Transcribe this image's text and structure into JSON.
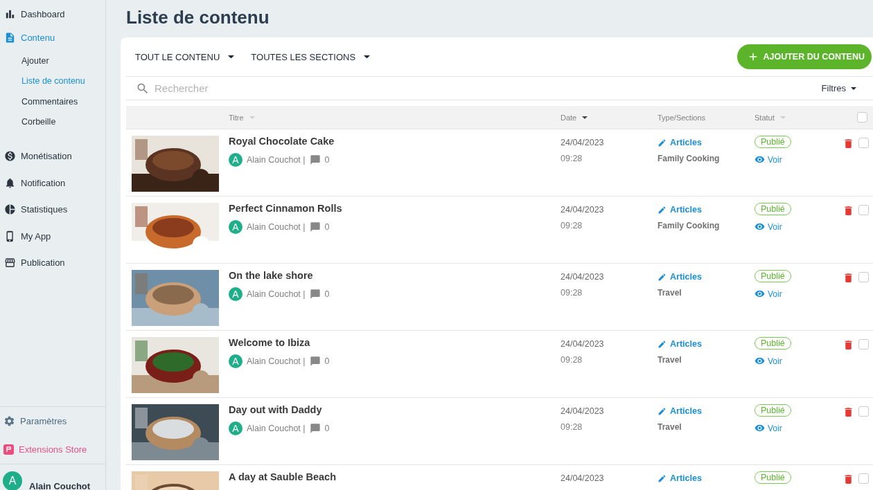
{
  "sidebar": {
    "items": [
      {
        "label": "Dashboard",
        "selected": false
      },
      {
        "label": "Contenu",
        "selected": true,
        "children": [
          {
            "label": "Ajouter",
            "selected": false
          },
          {
            "label": "Liste de contenu",
            "selected": true
          },
          {
            "label": "Commentaires",
            "selected": false
          },
          {
            "label": "Corbeille",
            "selected": false
          }
        ]
      },
      {
        "label": "Monétisation",
        "selected": false
      },
      {
        "label": "Notification",
        "selected": false
      },
      {
        "label": "Statistiques",
        "selected": false
      },
      {
        "label": "My App",
        "selected": false
      },
      {
        "label": "Publication",
        "selected": false
      }
    ],
    "footer": [
      {
        "label": "Paramètres",
        "kind": "settings"
      },
      {
        "label": "Extensions Store",
        "kind": "store"
      }
    ],
    "user": {
      "initial": "A",
      "name": "Alain Couchot"
    }
  },
  "page": {
    "title": "Liste de contenu"
  },
  "toolbar": {
    "dropdowns": [
      "TOUT LE CONTENU",
      "TOUTES LES SECTIONS"
    ],
    "add_button": "AJOUTER DU CONTENU"
  },
  "search": {
    "placeholder": "Rechercher",
    "filters": "Filtres"
  },
  "table": {
    "columns": [
      {
        "label": "Titre",
        "sortable": true,
        "selected": false
      },
      {
        "label": "Date",
        "sortable": true,
        "selected": true
      },
      {
        "label": "Type/Sections",
        "sortable": false
      },
      {
        "label": "Statut",
        "sortable": true,
        "selected": false
      }
    ],
    "select_all": {
      "checked": false
    },
    "rows": [
      {
        "title": "Royal Chocolate Cake",
        "author_initial": "A",
        "author": "Alain Couchot |",
        "comments": "0",
        "date": "24/04/2023",
        "time": "09:28",
        "type": "Articles",
        "section": "Family Cooking",
        "status": "Publié",
        "view": "Voir",
        "checked": false
      },
      {
        "title": "Perfect Cinnamon Rolls",
        "author_initial": "A",
        "author": "Alain Couchot |",
        "comments": "0",
        "date": "24/04/2023",
        "time": "09:28",
        "type": "Articles",
        "section": "Family Cooking",
        "status": "Publié",
        "view": "Voir",
        "checked": false
      },
      {
        "title": "On the lake shore",
        "author_initial": "A",
        "author": "Alain Couchot |",
        "comments": "0",
        "date": "24/04/2023",
        "time": "09:28",
        "type": "Articles",
        "section": "Travel",
        "status": "Publié",
        "view": "Voir",
        "checked": false
      },
      {
        "title": "Welcome to Ibiza",
        "author_initial": "A",
        "author": "Alain Couchot |",
        "comments": "0",
        "date": "24/04/2023",
        "time": "09:28",
        "type": "Articles",
        "section": "Travel",
        "status": "Publié",
        "view": "Voir",
        "checked": false
      },
      {
        "title": "Day out with Daddy",
        "author_initial": "A",
        "author": "Alain Couchot |",
        "comments": "0",
        "date": "24/04/2023",
        "time": "09:28",
        "type": "Articles",
        "section": "Travel",
        "status": "Publié",
        "view": "Voir",
        "checked": false
      },
      {
        "title": "A day at Sauble Beach",
        "date": "24/04/2023",
        "type": "Articles",
        "status": "Publié",
        "checked": false
      }
    ]
  }
}
